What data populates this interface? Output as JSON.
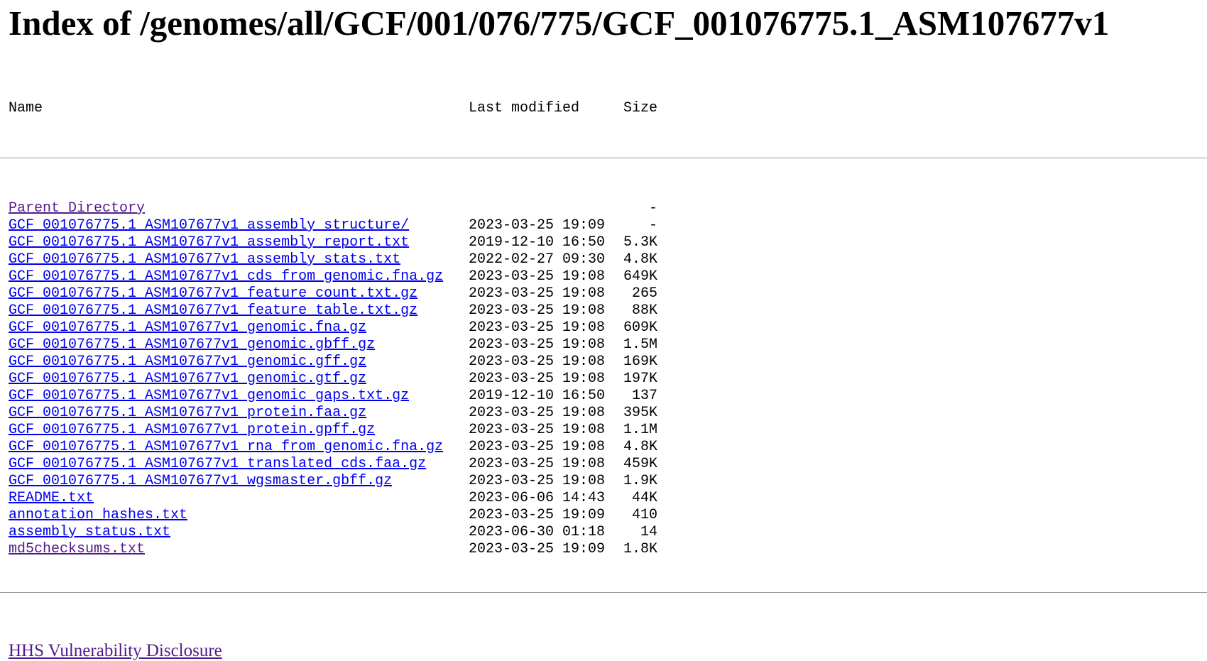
{
  "title": "Index of /genomes/all/GCF/001/076/775/GCF_001076775.1_ASM107677v1",
  "columns": {
    "name": "Name",
    "modified": "Last modified",
    "size": "Size"
  },
  "rows": [
    {
      "name": "Parent Directory",
      "modified": "",
      "size": "-",
      "visited": true
    },
    {
      "name": "GCF_001076775.1_ASM107677v1_assembly_structure/",
      "modified": "2023-03-25 19:09",
      "size": "-",
      "visited": false
    },
    {
      "name": "GCF_001076775.1_ASM107677v1_assembly_report.txt",
      "modified": "2019-12-10 16:50",
      "size": "5.3K",
      "visited": false
    },
    {
      "name": "GCF_001076775.1_ASM107677v1_assembly_stats.txt",
      "modified": "2022-02-27 09:30",
      "size": "4.8K",
      "visited": false
    },
    {
      "name": "GCF_001076775.1_ASM107677v1_cds_from_genomic.fna.gz",
      "modified": "2023-03-25 19:08",
      "size": "649K",
      "visited": false
    },
    {
      "name": "GCF_001076775.1_ASM107677v1_feature_count.txt.gz",
      "modified": "2023-03-25 19:08",
      "size": "265",
      "visited": false
    },
    {
      "name": "GCF_001076775.1_ASM107677v1_feature_table.txt.gz",
      "modified": "2023-03-25 19:08",
      "size": "88K",
      "visited": false
    },
    {
      "name": "GCF_001076775.1_ASM107677v1_genomic.fna.gz",
      "modified": "2023-03-25 19:08",
      "size": "609K",
      "visited": false
    },
    {
      "name": "GCF_001076775.1_ASM107677v1_genomic.gbff.gz",
      "modified": "2023-03-25 19:08",
      "size": "1.5M",
      "visited": false
    },
    {
      "name": "GCF_001076775.1_ASM107677v1_genomic.gff.gz",
      "modified": "2023-03-25 19:08",
      "size": "169K",
      "visited": false
    },
    {
      "name": "GCF_001076775.1_ASM107677v1_genomic.gtf.gz",
      "modified": "2023-03-25 19:08",
      "size": "197K",
      "visited": false
    },
    {
      "name": "GCF_001076775.1_ASM107677v1_genomic_gaps.txt.gz",
      "modified": "2019-12-10 16:50",
      "size": "137",
      "visited": false
    },
    {
      "name": "GCF_001076775.1_ASM107677v1_protein.faa.gz",
      "modified": "2023-03-25 19:08",
      "size": "395K",
      "visited": false
    },
    {
      "name": "GCF_001076775.1_ASM107677v1_protein.gpff.gz",
      "modified": "2023-03-25 19:08",
      "size": "1.1M",
      "visited": false
    },
    {
      "name": "GCF_001076775.1_ASM107677v1_rna_from_genomic.fna.gz",
      "modified": "2023-03-25 19:08",
      "size": "4.8K",
      "visited": false
    },
    {
      "name": "GCF_001076775.1_ASM107677v1_translated_cds.faa.gz",
      "modified": "2023-03-25 19:08",
      "size": "459K",
      "visited": false
    },
    {
      "name": "GCF_001076775.1_ASM107677v1_wgsmaster.gbff.gz",
      "modified": "2023-03-25 19:08",
      "size": "1.9K",
      "visited": false
    },
    {
      "name": "README.txt",
      "modified": "2023-06-06 14:43",
      "size": "44K",
      "visited": false
    },
    {
      "name": "annotation_hashes.txt",
      "modified": "2023-03-25 19:09",
      "size": "410",
      "visited": false
    },
    {
      "name": "assembly_status.txt",
      "modified": "2023-06-30 01:18",
      "size": "14",
      "visited": false
    },
    {
      "name": "md5checksums.txt",
      "modified": "2023-03-25 19:09",
      "size": "1.8K",
      "visited": true
    }
  ],
  "footer": {
    "link_label": "HHS Vulnerability Disclosure"
  },
  "colors": {
    "link": "#0000ee",
    "visited": "#551a8b",
    "rule": "#9a9a9a"
  }
}
